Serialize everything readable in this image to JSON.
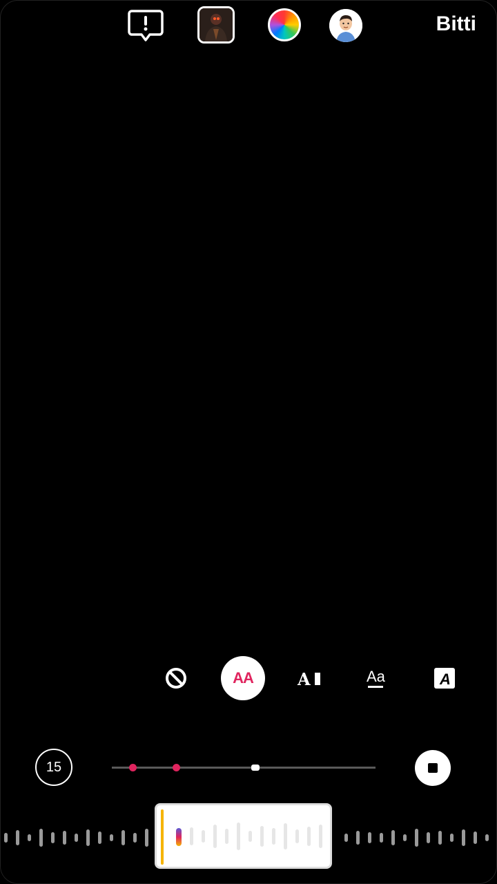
{
  "topbar": {
    "alert_icon": "exclamation-bubble-icon",
    "thumbnail_icon": "sticker-thumbnail",
    "color_icon": "color-wheel-icon",
    "avatar_icon": "avatar-icon",
    "done_label": "Bitti"
  },
  "style_bar": {
    "items": [
      {
        "name": "no-style",
        "icon": "ban-icon"
      },
      {
        "name": "classic",
        "label": "AA",
        "selected": true,
        "color": "#e0245e"
      },
      {
        "name": "bold-bar",
        "label": "A"
      },
      {
        "name": "underline",
        "label": "Aa"
      },
      {
        "name": "boxed",
        "label": "A"
      }
    ]
  },
  "timeline": {
    "duration": "15",
    "stop_icon": "stop-icon",
    "accent": "#e0245e"
  },
  "music": {
    "accent": "#f5b400"
  }
}
